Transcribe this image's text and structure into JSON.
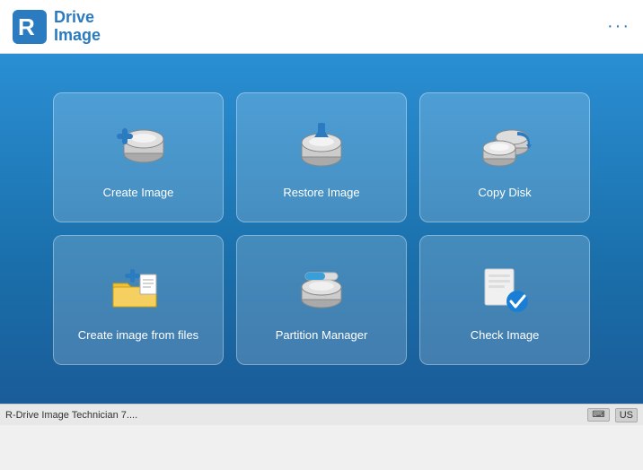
{
  "header": {
    "title_line1": "Drive",
    "title_line2": "Image",
    "menu_dots": "···"
  },
  "grid": {
    "items": [
      {
        "id": "create-image",
        "label": "Create Image"
      },
      {
        "id": "restore-image",
        "label": "Restore Image"
      },
      {
        "id": "copy-disk",
        "label": "Copy Disk"
      },
      {
        "id": "create-image-files",
        "label": "Create image from files"
      },
      {
        "id": "partition-manager",
        "label": "Partition Manager"
      },
      {
        "id": "check-image",
        "label": "Check Image"
      }
    ]
  },
  "statusbar": {
    "left_text": "R-Drive Image Technician 7....",
    "keyboard_label": "⌨",
    "lang_label": "US"
  }
}
